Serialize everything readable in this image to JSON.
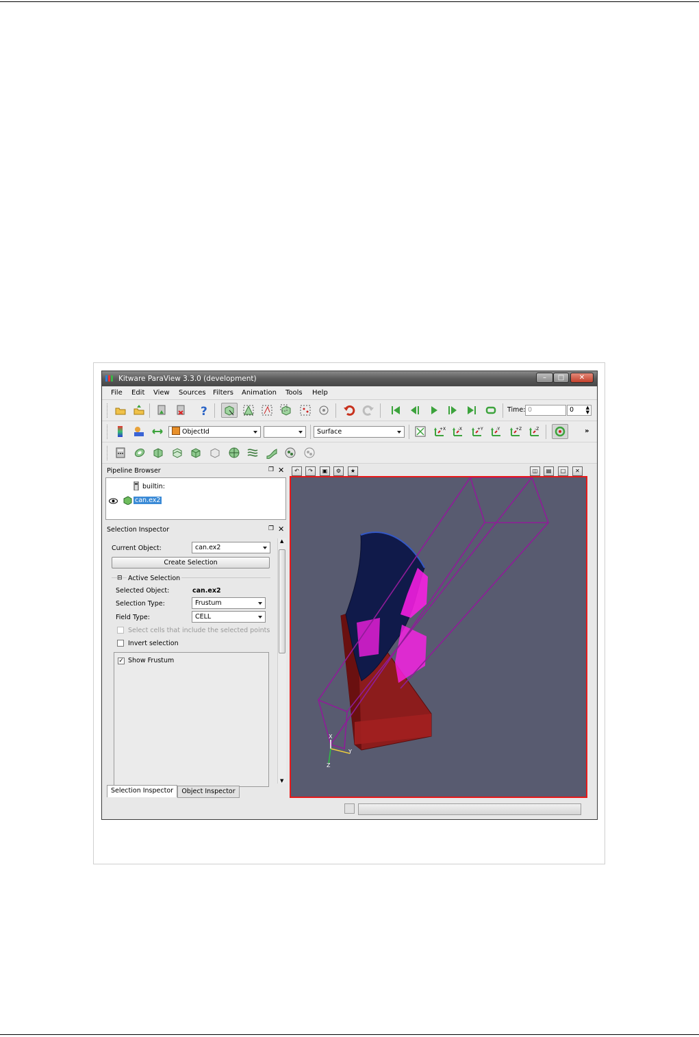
{
  "window": {
    "title": "Kitware ParaView 3.3.0 (development)"
  },
  "menu": [
    "File",
    "Edit",
    "View",
    "Sources",
    "Filters",
    "Animation",
    "Tools",
    "Help"
  ],
  "toolbar": {
    "time_label": "Time:",
    "time_value": "0",
    "time_step": "0",
    "color_by": "ObjectId",
    "component": "",
    "representation": "Surface",
    "overflow": "»",
    "camera_labels": [
      "+X",
      "-X",
      "+Y",
      "-Y",
      "+Z",
      "-Z"
    ]
  },
  "pipeline_browser": {
    "title": "Pipeline Browser",
    "items": [
      {
        "label": "builtin:"
      },
      {
        "label": "can.ex2"
      }
    ]
  },
  "selection_inspector": {
    "title": "Selection Inspector",
    "current_object_label": "Current Object:",
    "current_object_value": "can.ex2",
    "create_selection": "Create Selection",
    "active_selection_group": "Active Selection",
    "selected_object_label": "Selected Object:",
    "selected_object_value": "can.ex2",
    "selection_type_label": "Selection Type:",
    "selection_type_value": "Frustum",
    "field_type_label": "Field Type:",
    "field_type_value": "CELL",
    "select_cells_label": "Select cells that include the selected points",
    "invert_selection_label": "Invert selection",
    "show_frustum_label": "Show Frustum",
    "show_frustum_checked": true
  },
  "tabs": [
    "Selection Inspector",
    "Object Inspector"
  ],
  "axes": {
    "x": "X",
    "y": "Y",
    "z": "Z"
  },
  "colors": {
    "viewport_bg": "#585b70",
    "active_view_border": "#e81919",
    "frustum": "#8f1c98",
    "selection": "#ff1fe8",
    "can_body": "#8c1c1c",
    "can_surface": "#101a4a"
  }
}
